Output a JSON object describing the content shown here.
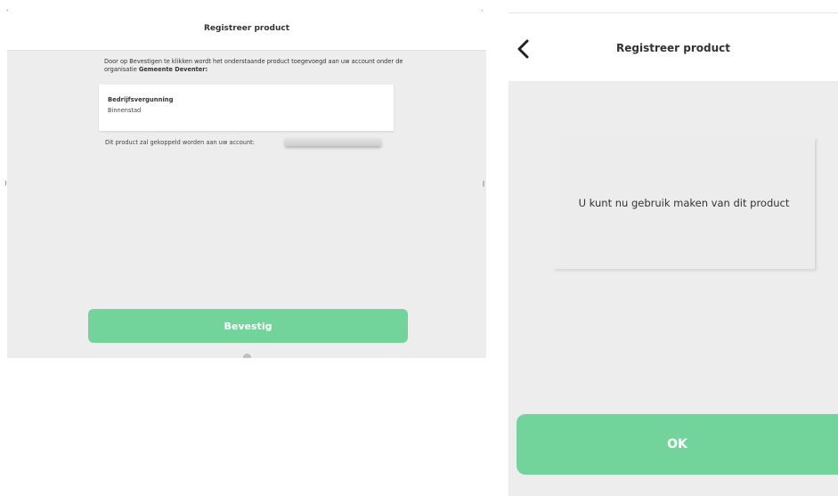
{
  "left_screen": {
    "title": "Registreer product",
    "intro_text": "Door op Bevestigen te klikken wordt het onderstaande product toegevoegd aan uw account onder de organisatie ",
    "organisation": "Gemeente Deventer:",
    "product": {
      "name": "Bedrijfsvergunning",
      "location": "Binnenstad"
    },
    "account_text": "Dit product zal gekoppeld worden aan uw account:",
    "confirm_button": "Bevestig"
  },
  "right_screen": {
    "title": "Registreer product",
    "back_icon": "chevron-left-icon",
    "message": "U kunt nu gebruik maken van dit product",
    "ok_button": "OK"
  },
  "colors": {
    "accent_green": "#72d49b",
    "background_grey": "#ededed",
    "header_white": "#ffffff"
  }
}
